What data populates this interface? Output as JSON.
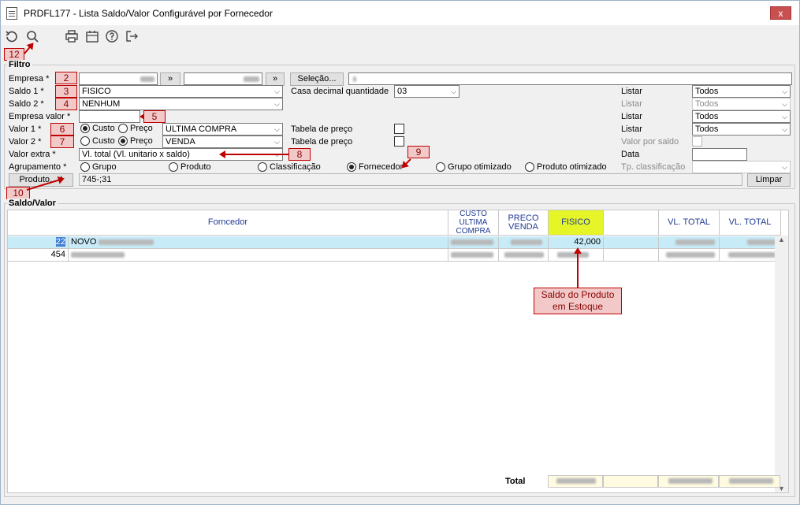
{
  "window": {
    "title": "PRDFL177 - Lista Saldo/Valor Configurável por Fornecedor",
    "close_label": "x"
  },
  "toolbar": {
    "icons": [
      "undo-icon",
      "search-icon",
      "print-icon",
      "calendar-icon",
      "help-icon",
      "exit-icon"
    ]
  },
  "badges": {
    "b12": "12",
    "b2": "2",
    "b3": "3",
    "b4": "4",
    "b5": "5",
    "b6": "6",
    "b7": "7",
    "b8": "8",
    "b9": "9",
    "b10": "10"
  },
  "filtro": {
    "legend": "Filtro",
    "empresa_label": "Empresa *",
    "empresa_btn": "»",
    "empresa2_btn": "»",
    "selecao_btn": "Seleção...",
    "saldo1_label": "Saldo 1 *",
    "saldo1_value": "FISICO",
    "saldo2_label": "Saldo 2 *",
    "saldo2_value": "NENHUM",
    "empresa_valor_label": "Empresa valor *",
    "valor1_label": "Valor 1 *",
    "valor1_custo": "Custo",
    "valor1_preco": "Preço",
    "valor1_value": "ULTIMA COMPRA",
    "valor2_label": "Valor 2 *",
    "valor2_custo": "Custo",
    "valor2_preco": "Preço",
    "valor2_value": "VENDA",
    "valor_extra_label": "Valor extra *",
    "valor_extra_value": "Vl. total (Vl. unitario x saldo)",
    "agrupamento_label": "Agrupamento *",
    "agrup_options": [
      "Grupo",
      "Produto",
      "Classificação",
      "Fornecedor",
      "Grupo otimizado",
      "Produto otimizado"
    ],
    "produto_btn": "Produto... *",
    "produto_value": "745-;31",
    "limpar_btn": "Limpar",
    "casa_decimal_label": "Casa decimal quantidade",
    "casa_decimal_value": "03",
    "tabela_preco1_label": "Tabela de preço",
    "tabela_preco2_label": "Tabela de preço",
    "listar1_label": "Listar",
    "listar1_value": "Todos",
    "listar2_label": "Listar",
    "listar2_value": "Todos",
    "listar3_label": "Listar",
    "listar3_value": "Todos",
    "listar4_label": "Listar",
    "listar4_value": "Todos",
    "valor_por_saldo_label": "Valor por saldo",
    "data_label": "Data",
    "tp_class_label": "Tp. classificação"
  },
  "saldo": {
    "legend": "Saldo/Valor",
    "columns": [
      "Forncedor",
      "CUSTO ULTIMA COMPRA",
      "PRECO VENDA",
      "FISICO",
      "",
      "VL. TOTAL",
      "VL. TOTAL"
    ],
    "rows": [
      {
        "code": "22",
        "name": "NOVO",
        "fisico": "42,000"
      },
      {
        "code": "454",
        "name": "",
        "fisico": ""
      }
    ],
    "total_label": "Total"
  },
  "callout": {
    "text": "Saldo do Produto em Estoque"
  }
}
